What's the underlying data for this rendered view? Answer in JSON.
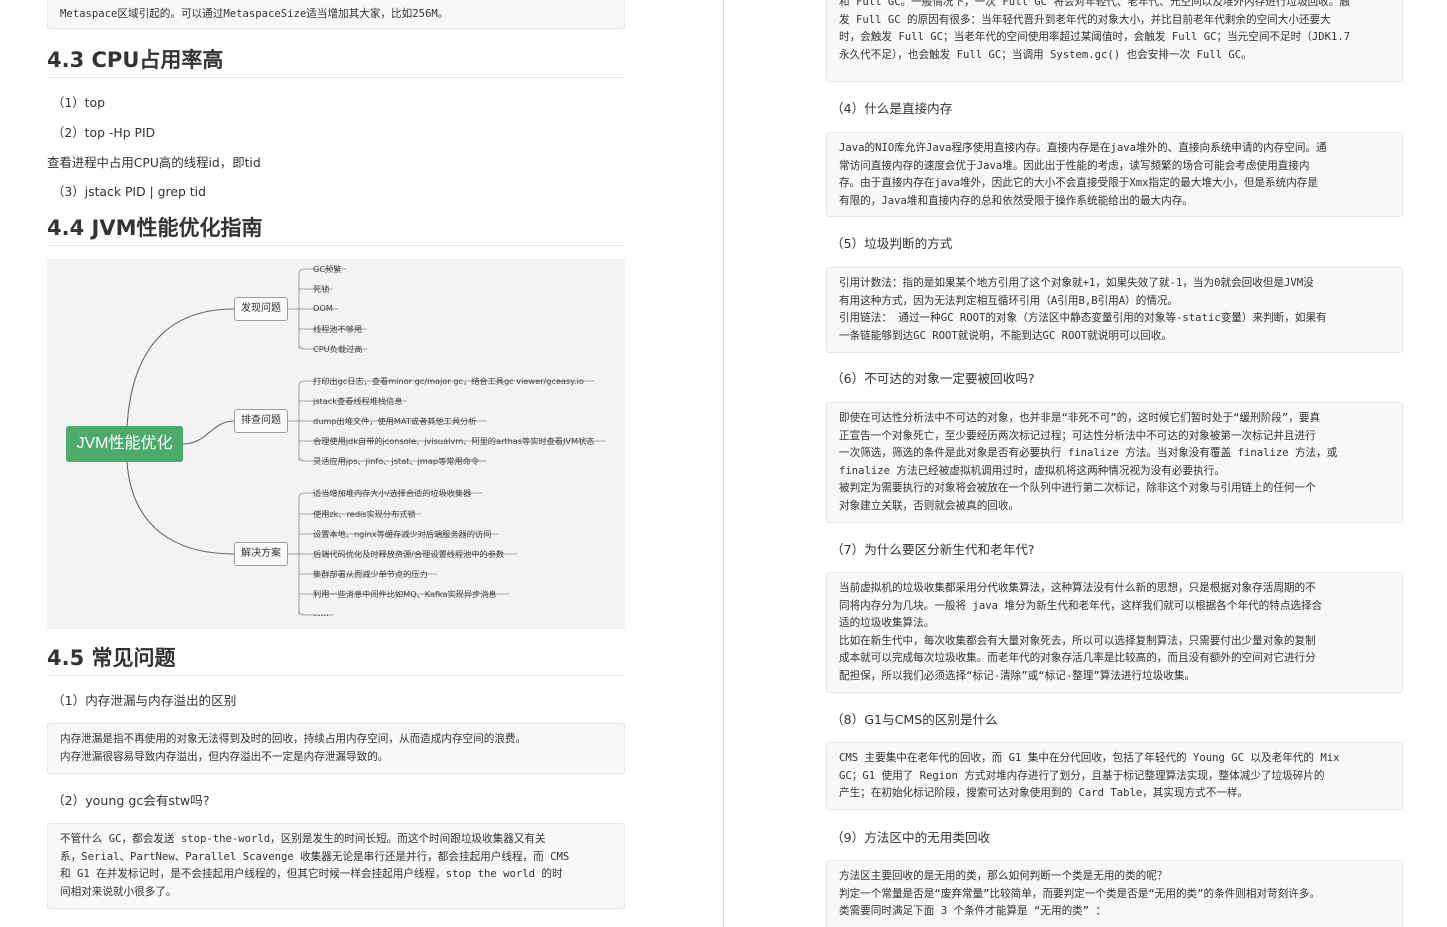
{
  "left": {
    "top_code_line": "Metaspace区域引起的。可以通过MetaspaceSize适当增加其大家，比如256M。",
    "sec43": {
      "title": "4.3 CPU占用率高",
      "items": [
        "（1）top",
        "（2）top -Hp PID",
        "查看进程中占用CPU高的线程id，即tid",
        "（3）jstack PID | grep tid"
      ]
    },
    "sec44": {
      "title": "4.4 JVM性能优化指南"
    },
    "mindmap": {
      "root": "JVM性能优化",
      "branches": [
        {
          "label": "发现问题",
          "leaves": [
            "GC频繁",
            "死锁",
            "OOM",
            "线程池不够用",
            "CPU负载过高"
          ]
        },
        {
          "label": "排查问题",
          "leaves": [
            "打印出gc日志，查看minor gc/major gc，结合工具gc viewer/gceasy.io",
            "jstack查看线程堆栈信息",
            "dump出堆文件，使用MAT或者其他工具分析",
            "合理使用jdk自带的jconsole、jvisualvm、阿里的arthas等实时查看JVM状态",
            "灵活应用jps、jinfo、jstat、jmap等常用命令"
          ]
        },
        {
          "label": "解决方案",
          "leaves": [
            "适当增加堆内存大小/选择合适的垃圾收集器",
            "使用zk、redis实现分布式锁",
            "设置本地、nginx等缓存减少对后端服务器的访问",
            "后端代码优化及时释放资源/合理设置线程池中的参数",
            "集群部署从而减少单节点的压力",
            "利用一些消息中间件比如MQ、Kafka实现异步消息",
            "......"
          ]
        }
      ]
    },
    "sec45": {
      "title": "4.5 常见问题",
      "q1": "（1）内存泄漏与内存溢出的区别",
      "a1": [
        "内存泄漏是指不再使用的对象无法得到及时的回收，持续占用内存空间，从而造成内存空间的浪费。",
        "内存泄漏很容易导致内存溢出，但内存溢出不一定是内存泄漏导致的。"
      ],
      "q2": "（2）young gc会有stw吗?",
      "a2": [
        "不管什么 GC，都会发送 stop-the-world，区别是发生的时间长短。而这个时间跟垃圾收集器又有关",
        "系，Serial、PartNew、Parallel Scavenge 收集器无论是串行还是并行，都会挂起用户线程，而 CMS",
        "和 G1 在并发标记时，是不会挂起用户线程的，但其它时候一样会挂起用户线程，stop the world 的时",
        "间相对来说就小很多了。"
      ]
    }
  },
  "right": {
    "top_code": [
      "和 Full GC。一般情况下，一次 Full GC 将会对年轻代、老年代、元空间以及堆外内存进行垃圾回收。触",
      "发 Full GC 的原因有很多：当年轻代晋升到老年代的对象大小，并比目前老年代剩余的空间大小还要大",
      "时，会触发 Full GC；当老年代的空间使用率超过某阈值时，会触发 Full GC；当元空间不足时（JDK1.7",
      "永久代不足），也会触发 Full GC；当调用 System.gc() 也会安排一次 Full GC。"
    ],
    "q4": "（4）什么是直接内存",
    "a4": [
      "Java的NIO库允许Java程序使用直接内存。直接内存是在java堆外的、直接向系统申请的内存空间。通",
      "常访问直接内存的速度会优于Java堆。因此出于性能的考虑，读写频繁的场合可能会考虑使用直接内",
      "存。由于直接内存在java堆外，因此它的大小不会直接受限于Xmx指定的最大堆大小，但是系统内存是",
      "有限的，Java堆和直接内存的总和依然受限于操作系统能给出的最大内存。"
    ],
    "q5": "（5）垃圾判断的方式",
    "a5": [
      "引用计数法：指的是如果某个地方引用了这个对象就+1，如果失效了就-1，当为0就会回收但是JVM没",
      "有用这种方式，因为无法判定相互循环引用（A引用B,B引用A）的情况。",
      "引用链法： 通过一种GC ROOT的对象（方法区中静态变量引用的对象等-static变量）来判断，如果有",
      "一条链能够到达GC ROOT就说明，不能到达GC ROOT就说明可以回收。"
    ],
    "q6": "（6）不可达的对象一定要被回收吗?",
    "a6": [
      "即使在可达性分析法中不可达的对象，也并非是“非死不可”的，这时候它们暂时处于“缓刑阶段”，要真",
      "正宣告一个对象死亡，至少要经历两次标记过程；可达性分析法中不可达的对象被第一次标记并且进行",
      "一次筛选，筛选的条件是此对象是否有必要执行 finalize 方法。当对象没有覆盖 finalize 方法，或",
      "finalize 方法已经被虚拟机调用过时，虚拟机将这两种情况视为没有必要执行。",
      "被判定为需要执行的对象将会被放在一个队列中进行第二次标记，除非这个对象与引用链上的任何一个",
      "对象建立关联，否则就会被真的回收。"
    ],
    "q7": "（7）为什么要区分新生代和老年代?",
    "a7": [
      "当前虚拟机的垃圾收集都采用分代收集算法，这种算法没有什么新的思想，只是根据对象存活周期的不",
      "同将内存分为几块。一般将 java 堆分为新生代和老年代，这样我们就可以根据各个年代的特点选择合",
      "适的垃圾收集算法。",
      "比如在新生代中，每次收集都会有大量对象死去，所以可以选择复制算法，只需要付出少量对象的复制",
      "成本就可以完成每次垃圾收集。而老年代的对象存活几率是比较高的，而且没有额外的空间对它进行分",
      "配担保，所以我们必须选择“标记-清除”或“标记-整理”算法进行垃圾收集。"
    ],
    "q8": "（8）G1与CMS的区别是什么",
    "a8": [
      "CMS 主要集中在老年代的回收，而 G1 集中在分代回收，包括了年轻代的 Young GC 以及老年代的 Mix",
      "GC；G1 使用了 Region 方式对堆内存进行了划分，且基于标记整理算法实现，整体减少了垃圾碎片的",
      "产生；在初始化标记阶段，搜索可达对象使用到的 Card Table，其实现方式不一样。"
    ],
    "q9": "（9）方法区中的无用类回收",
    "a9": [
      "方法区主要回收的是无用的类，那么如何判断一个类是无用的类的呢？",
      "判定一个常量是否是“废弃常量”比较简单，而要判定一个类是否是“无用的类”的条件则相对苛刻许多。",
      "类需要同时满足下面 3 个条件才能算是 “无用的类” ："
    ]
  }
}
